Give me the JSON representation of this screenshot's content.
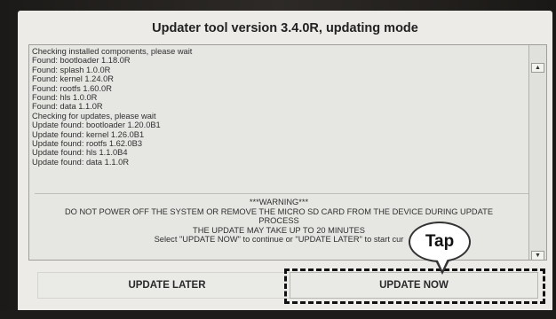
{
  "window": {
    "title": "Updater tool version 3.4.0R, updating mode"
  },
  "log": {
    "lines": [
      "Checking installed components, please wait",
      "Found: bootloader 1.18.0R",
      "Found: splash 1.0.0R",
      "Found: kernel 1.24.0R",
      "Found: rootfs 1.60.0R",
      "Found: hls 1.0.0R",
      "Found: data 1.1.0R",
      "Checking for updates, please wait",
      "Update found: bootloader 1.20.0B1",
      "Update found: kernel 1.26.0B1",
      "Update found: rootfs 1.62.0B3",
      "Update found: hls 1.1.0B4",
      "Update found: data 1.1.0R"
    ],
    "warning": {
      "heading": "***WARNING***",
      "line1": "DO NOT POWER OFF THE SYSTEM OR REMOVE THE MICRO SD CARD FROM THE DEVICE DURING UPDATE",
      "line2": "PROCESS",
      "line3": "THE UPDATE MAY TAKE UP TO 20 MINUTES",
      "line4": "Select \"UPDATE NOW\" to continue or \"UPDATE LATER\" to start cur"
    }
  },
  "scrollbar": {
    "up_icon": "▲",
    "down_icon": "▼"
  },
  "callout": {
    "label": "Tap"
  },
  "buttons": {
    "later_label": "UPDATE LATER",
    "now_label": "UPDATE NOW"
  }
}
